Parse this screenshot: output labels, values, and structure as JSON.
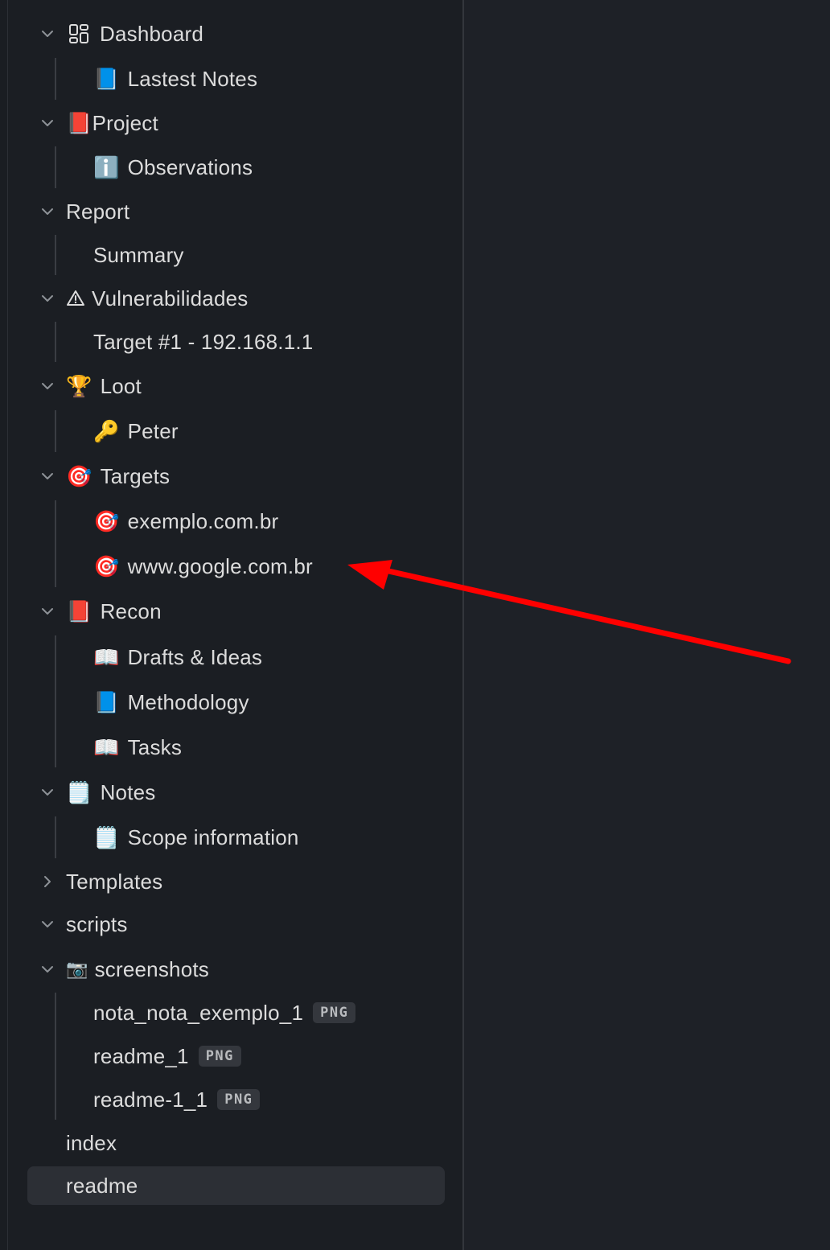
{
  "sidebar": {
    "items": [
      {
        "label": "Dashboard",
        "icon": "dashboard-grid-icon",
        "expanded": true
      },
      {
        "label": "Lastest Notes",
        "icon": "blue-book-icon"
      },
      {
        "label": "Project",
        "icon": "red-book-icon",
        "expanded": true
      },
      {
        "label": "Observations",
        "icon": "information-icon"
      },
      {
        "label": "Report",
        "expanded": true
      },
      {
        "label": "Summary"
      },
      {
        "label": "Vulnerabilidades",
        "icon": "warning-icon",
        "expanded": true
      },
      {
        "label": "Target #1 - 192.168.1.1"
      },
      {
        "label": "Loot",
        "icon": "trophy-icon",
        "expanded": true
      },
      {
        "label": "Peter",
        "icon": "key-icon"
      },
      {
        "label": "Targets",
        "icon": "dart-target-icon",
        "expanded": true
      },
      {
        "label": "exemplo.com.br",
        "icon": "dart-target-icon"
      },
      {
        "label": "www.google.com.br",
        "icon": "dart-target-icon"
      },
      {
        "label": "Recon",
        "icon": "red-book-icon",
        "expanded": true
      },
      {
        "label": "Drafts & Ideas",
        "icon": "open-book-icon"
      },
      {
        "label": "Methodology",
        "icon": "blue-book-icon"
      },
      {
        "label": "Tasks",
        "icon": "open-book-icon"
      },
      {
        "label": "Notes",
        "icon": "notepad-icon",
        "expanded": true
      },
      {
        "label": "Scope information",
        "icon": "notepad-icon"
      },
      {
        "label": "Templates",
        "expanded": false
      },
      {
        "label": "scripts",
        "expanded": true
      },
      {
        "label": "screenshots",
        "icon": "camera-icon",
        "expanded": true
      },
      {
        "label": "nota_nota_exemplo_1",
        "badge": "PNG"
      },
      {
        "label": "readme_1",
        "badge": "PNG"
      },
      {
        "label": "readme-1_1",
        "badge": "PNG"
      },
      {
        "label": "index"
      },
      {
        "label": "readme",
        "active": true
      }
    ]
  },
  "annotation": {
    "type": "red-arrow",
    "color": "#ff0000",
    "points_to": "www.google.com.br"
  },
  "colors": {
    "sidebar_bg": "#1b1e23",
    "editor_bg": "#1e2127",
    "text": "#dcdcdc",
    "active_row_bg": "#2c2f35",
    "badge_bg": "#34373d",
    "arrow": "#ff0000"
  }
}
